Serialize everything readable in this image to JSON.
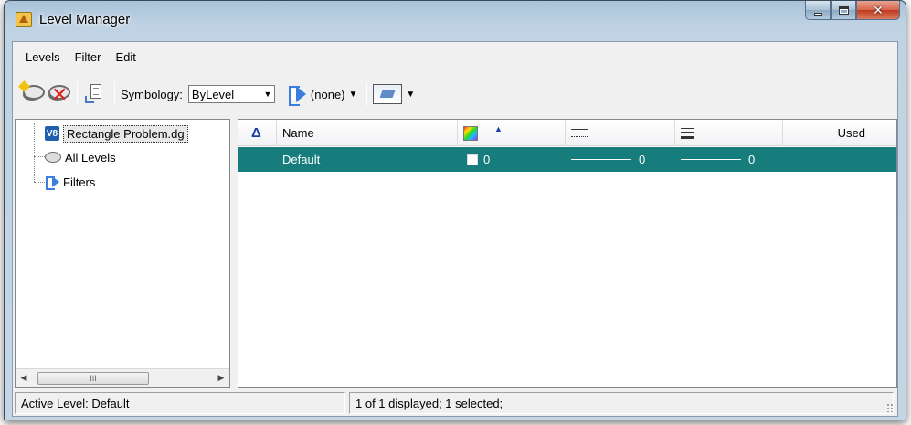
{
  "window": {
    "title": "Level Manager"
  },
  "menu": {
    "items": [
      {
        "label": "Levels"
      },
      {
        "label": "Filter"
      },
      {
        "label": "Edit"
      }
    ]
  },
  "toolbar": {
    "symbology_label": "Symbology:",
    "symbology_value": "ByLevel",
    "filter_value": "(none)",
    "icons": [
      "new-level-icon",
      "delete-level-icon",
      "import-export-icon",
      "filter-icon",
      "display-settings-icon"
    ]
  },
  "tree": {
    "items": [
      {
        "label": "Rectangle Problem.dg"
      },
      {
        "label": "All Levels"
      },
      {
        "label": "Filters"
      }
    ],
    "scroll_thumb": "III"
  },
  "grid": {
    "columns": [
      "Name",
      "Used"
    ],
    "rows": [
      {
        "name": "Default",
        "color": "0",
        "style": "0",
        "weight": "0",
        "used": ""
      }
    ],
    "selected_color": "#167c7c"
  },
  "status": {
    "active_level": "Active Level: Default",
    "display_info": "1 of 1 displayed; 1 selected;"
  }
}
